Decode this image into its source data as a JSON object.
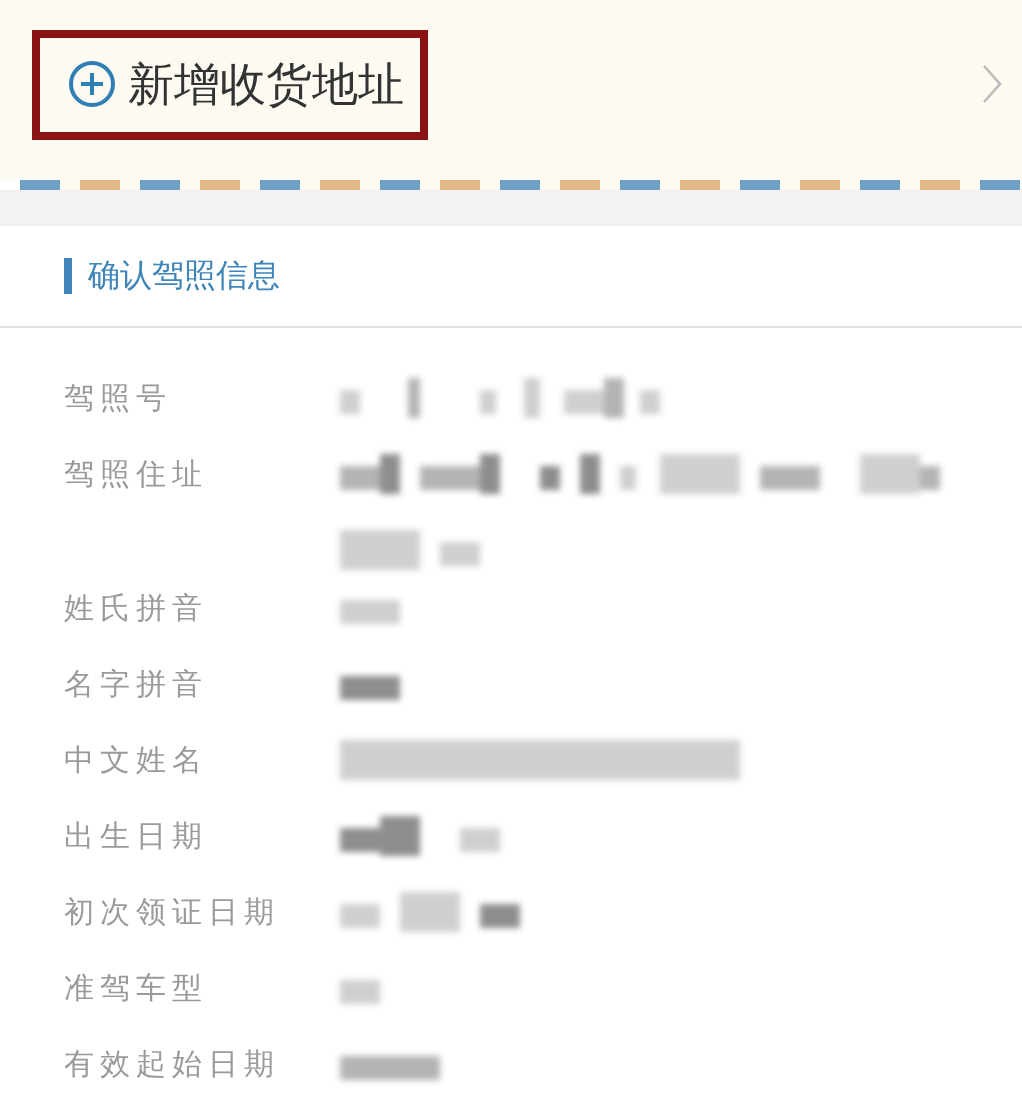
{
  "add_address": {
    "label": "新增收货地址",
    "highlighted": true
  },
  "section": {
    "title": "确认驾照信息"
  },
  "fields": [
    {
      "label": "驾照号",
      "value_blurred": true
    },
    {
      "label": "驾照住址",
      "value_blurred": true
    },
    {
      "label": "姓氏拼音",
      "value_blurred": true
    },
    {
      "label": "名字拼音",
      "value_blurred": true
    },
    {
      "label": "中文姓名",
      "value_blurred": true
    },
    {
      "label": "出生日期",
      "value_blurred": true
    },
    {
      "label": "初次领证日期",
      "value_blurred": true
    },
    {
      "label": "准驾车型",
      "value_blurred": true
    },
    {
      "label": "有效起始日期",
      "value_blurred": true
    }
  ]
}
